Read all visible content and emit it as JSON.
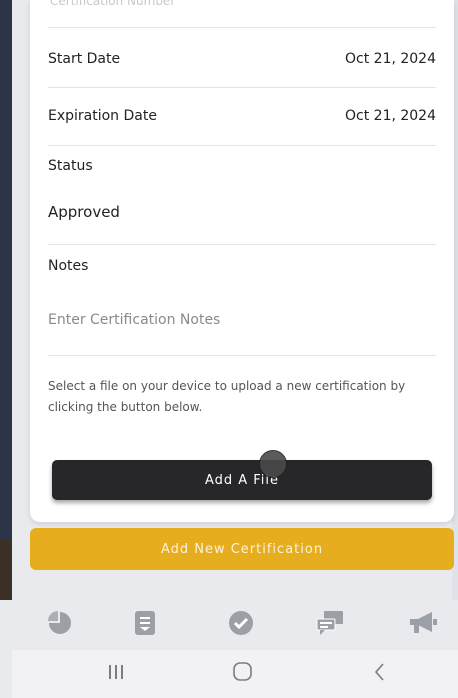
{
  "form": {
    "faded_top_text": "Certification Number",
    "start_date_label": "Start Date",
    "start_date_value": "Oct 21, 2024",
    "expiration_date_label": "Expiration Date",
    "expiration_date_value": "Oct 21, 2024",
    "status_label": "Status",
    "status_value": "Approved",
    "notes_label": "Notes",
    "notes_placeholder": "Enter Certification Notes",
    "upload_helper": "Select a file on your device to upload a new certification by clicking the button below.",
    "add_file_label": "Add A File"
  },
  "actions": {
    "add_new_certification": "Add New Certification"
  },
  "tabbar": {
    "items": [
      {
        "icon": "pie-chart-icon"
      },
      {
        "icon": "document-icon"
      },
      {
        "icon": "check-circle-icon"
      },
      {
        "icon": "chat-icon"
      },
      {
        "icon": "megaphone-icon"
      }
    ]
  },
  "colors": {
    "accent": "#e6ad1e",
    "button_dark": "#27272b",
    "icon_gray": "#9aa0a6"
  }
}
